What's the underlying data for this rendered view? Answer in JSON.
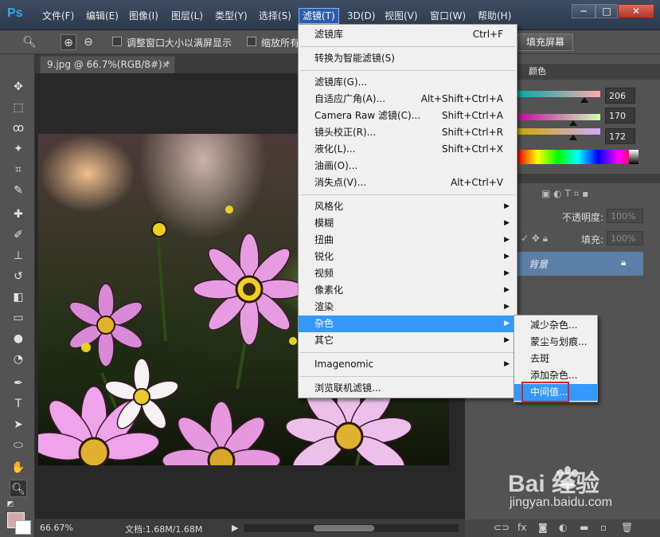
{
  "app": {
    "logo": "Ps"
  },
  "menubar": {
    "items": [
      "文件(F)",
      "编辑(E)",
      "图像(I)",
      "图层(L)",
      "类型(Y)",
      "选择(S)",
      "滤镜(T)",
      "3D(D)",
      "视图(V)",
      "窗口(W)",
      "帮助(H)"
    ],
    "active_index": 6
  },
  "window_buttons": {
    "minimize": "─",
    "restore": "□",
    "close": "✕"
  },
  "options_bar": {
    "resize_window_label": "调整窗口大小以满屏显示",
    "zoom_all_label": "缩放所有",
    "fill_screen_label": "填充屏幕"
  },
  "document": {
    "tab_title": "9.jpg @ 66.7%(RGB/8#) *",
    "tab_close": "×"
  },
  "status": {
    "zoom": "66.67%",
    "doc_size": "文档:1.68M/1.68M"
  },
  "color_panel": {
    "tab": "颜色",
    "r": "206",
    "g": "170",
    "b": "172",
    "r_fraction": 0.81,
    "g_fraction": 0.67,
    "b_fraction": 0.67
  },
  "layers_panel": {
    "opacity_label": "不透明度:",
    "opacity_value": "100%",
    "fill_label": "填充:",
    "fill_value": "100%",
    "layer_name": "背景"
  },
  "filter_menu": {
    "items": [
      {
        "label": "滤镜库",
        "shortcut": "Ctrl+F"
      },
      {
        "sep": true
      },
      {
        "label": "转换为智能滤镜(S)"
      },
      {
        "sep": true
      },
      {
        "label": "滤镜库(G)..."
      },
      {
        "label": "自适应广角(A)...",
        "shortcut": "Alt+Shift+Ctrl+A"
      },
      {
        "label": "Camera Raw 滤镜(C)...",
        "shortcut": "Shift+Ctrl+A"
      },
      {
        "label": "镜头校正(R)...",
        "shortcut": "Shift+Ctrl+R"
      },
      {
        "label": "液化(L)...",
        "shortcut": "Shift+Ctrl+X"
      },
      {
        "label": "油画(O)..."
      },
      {
        "label": "消失点(V)...",
        "shortcut": "Alt+Ctrl+V"
      },
      {
        "sep": true
      },
      {
        "label": "风格化",
        "submenu": true
      },
      {
        "label": "模糊",
        "submenu": true
      },
      {
        "label": "扭曲",
        "submenu": true
      },
      {
        "label": "锐化",
        "submenu": true
      },
      {
        "label": "视频",
        "submenu": true
      },
      {
        "label": "像素化",
        "submenu": true
      },
      {
        "label": "渲染",
        "submenu": true
      },
      {
        "label": "杂色",
        "submenu": true,
        "highlighted": true
      },
      {
        "label": "其它",
        "submenu": true
      },
      {
        "sep": true
      },
      {
        "label": "Imagenomic",
        "submenu": true
      },
      {
        "sep": true
      },
      {
        "label": "浏览联机滤镜..."
      }
    ]
  },
  "noise_submenu": {
    "items": [
      {
        "label": "减少杂色..."
      },
      {
        "label": "蒙尘与划痕..."
      },
      {
        "label": "去斑"
      },
      {
        "label": "添加杂色..."
      },
      {
        "label": "中间值...",
        "highlighted": true
      }
    ]
  },
  "watermark": {
    "brand": "Bai  经验",
    "url": "jingyan.baidu.com"
  }
}
